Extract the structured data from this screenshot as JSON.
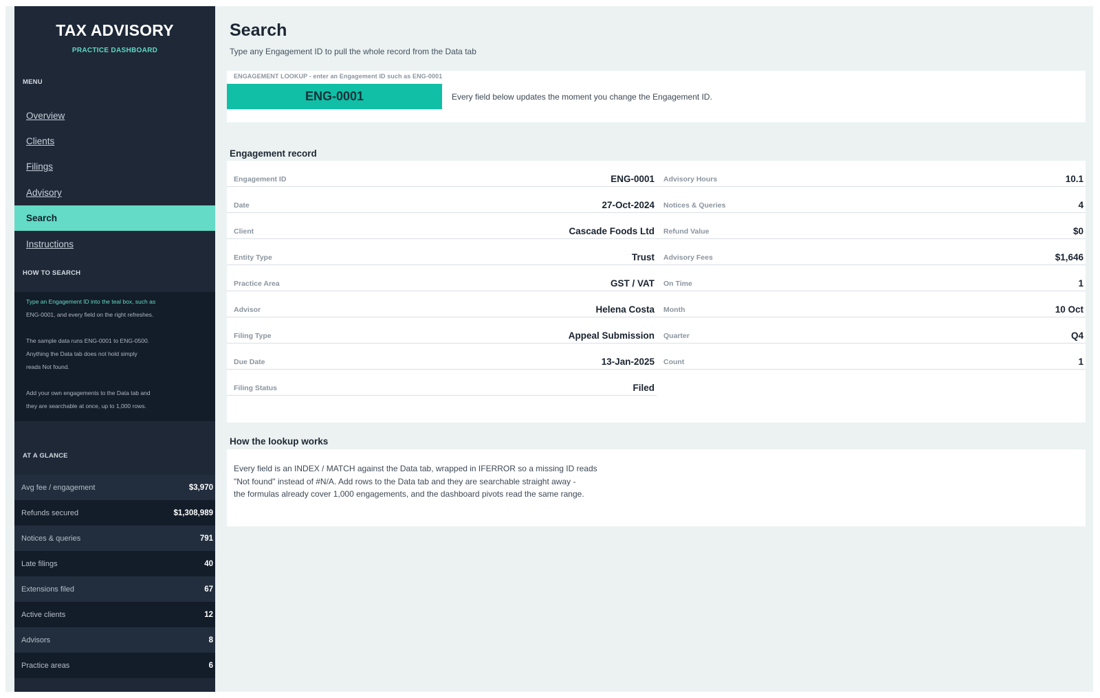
{
  "sidebar": {
    "brand_title": "TAX ADVISORY",
    "brand_subtitle": "PRACTICE DASHBOARD",
    "menu_label": "MENU",
    "nav": [
      "Overview",
      "Clients",
      "Filings",
      "Advisory",
      "Search",
      "Instructions"
    ],
    "active_nav": "Search",
    "howto_label": "HOW TO SEARCH",
    "howto_lines": [
      "Type an Engagement ID into the teal box, such as",
      "ENG-0001, and every field on the right refreshes.",
      "",
      "The sample data runs ENG-0001 to ENG-0500.",
      "Anything the Data tab does not hold simply",
      "reads Not found.",
      "",
      "Add your own engagements to the Data tab and",
      "they are searchable at once, up to 1,000 rows."
    ],
    "glance_label": "AT A GLANCE",
    "glance": [
      {
        "label": "Avg fee / engagement",
        "value": "$3,970"
      },
      {
        "label": "Refunds secured",
        "value": "$1,308,989"
      },
      {
        "label": "Notices & queries",
        "value": "791"
      },
      {
        "label": "Late filings",
        "value": "40"
      },
      {
        "label": "Extensions filed",
        "value": "67"
      },
      {
        "label": "Active clients",
        "value": "12"
      },
      {
        "label": "Advisors",
        "value": "8"
      },
      {
        "label": "Practice areas",
        "value": "6"
      }
    ]
  },
  "main": {
    "title": "Search",
    "subtitle": "Type any Engagement ID to pull the whole record from the Data tab",
    "lookup": {
      "caption": "ENGAGEMENT LOOKUP  -  enter an Engagement ID such as ENG-0001",
      "value": "ENG-0001",
      "hint": "Every field below updates the moment you change the Engagement ID."
    },
    "record_title": "Engagement record",
    "record_left": [
      {
        "label": "Engagement ID",
        "value": "ENG-0001"
      },
      {
        "label": "Date",
        "value": "27-Oct-2024"
      },
      {
        "label": "Client",
        "value": "Cascade Foods Ltd"
      },
      {
        "label": "Entity Type",
        "value": "Trust"
      },
      {
        "label": "Practice Area",
        "value": "GST / VAT"
      },
      {
        "label": "Advisor",
        "value": "Helena Costa"
      },
      {
        "label": "Filing Type",
        "value": "Appeal Submission"
      },
      {
        "label": "Due Date",
        "value": "13-Jan-2025"
      },
      {
        "label": "Filing Status",
        "value": "Filed"
      }
    ],
    "record_right": [
      {
        "label": "Advisory Hours",
        "value": "10.1"
      },
      {
        "label": "Notices & Queries",
        "value": "4"
      },
      {
        "label": "Refund Value",
        "value": "$0"
      },
      {
        "label": "Advisory Fees",
        "value": "$1,646"
      },
      {
        "label": "On Time",
        "value": "1"
      },
      {
        "label": "Month",
        "value": "10 Oct"
      },
      {
        "label": "Quarter",
        "value": "Q4"
      },
      {
        "label": "Count",
        "value": "1"
      }
    ],
    "explain_title": "How the lookup works",
    "explain_lines": [
      "Every field is an INDEX / MATCH against the Data tab, wrapped in IFERROR so a missing ID reads",
      "\"Not found\" instead of #N/A. Add rows to the Data tab and they are searchable straight away -",
      "the formulas already cover 1,000 engagements, and the dashboard pivots read the same range."
    ]
  },
  "colors": {
    "sidebar_bg": "#1e2837",
    "sidebar_dark": "#131c29",
    "accent_teal": "#63dbc6",
    "lookup_teal": "#10bfa5",
    "page_bg": "#ecf2f2"
  }
}
